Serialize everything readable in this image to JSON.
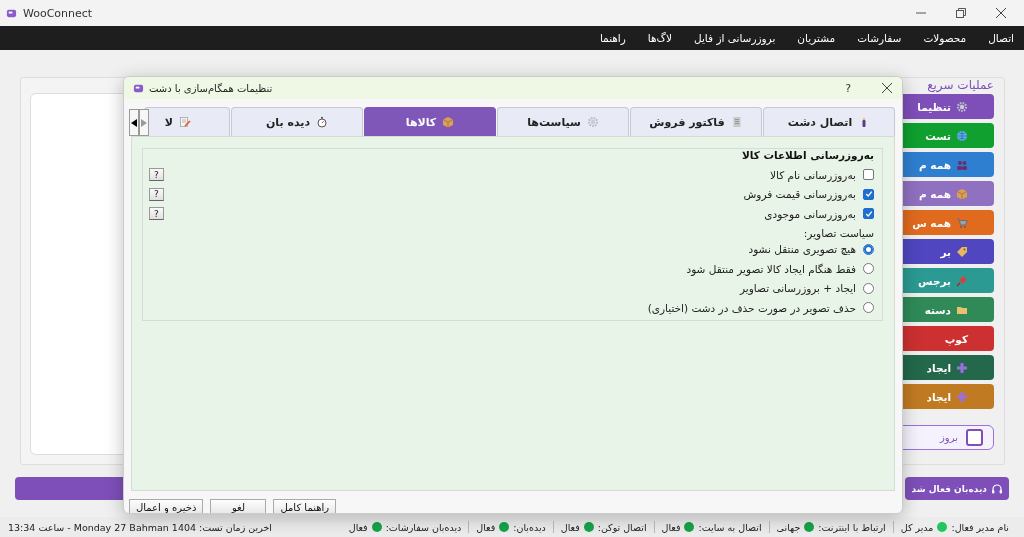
{
  "window": {
    "title": "WooConnect"
  },
  "menu": [
    "اتصال",
    "محصولات",
    "سفارشات",
    "مشتریان",
    "بروزرسانی از فایل",
    "لاگ‌ها",
    "راهنما"
  ],
  "quick_actions": {
    "title": "عملیات سریع",
    "buttons": [
      {
        "label": "تنظیما",
        "color": "#7e4fb8"
      },
      {
        "label": "تست",
        "color": "#0fa02f"
      },
      {
        "label": "همه م",
        "color": "#2f7fd0"
      },
      {
        "label": "همه م",
        "color": "#9070c0"
      },
      {
        "label": "همه س",
        "color": "#e06a1e"
      },
      {
        "label": "بر",
        "color": "#4f46c0"
      },
      {
        "label": "برجس",
        "color": "#2a9a92"
      },
      {
        "label": "دسته",
        "color": "#2f8a58"
      },
      {
        "label": "کوپ",
        "color": "#cc3030"
      },
      {
        "label": "ایجاد",
        "color": "#23684a"
      },
      {
        "label": "ایجاد",
        "color": "#c07a22"
      }
    ],
    "toggle": {
      "label": "بروز",
      "checked": false
    }
  },
  "watch_button": {
    "label": "دیده‌بان فعال شد"
  },
  "dialog": {
    "title": "تنظیمات همگام‌سازی با دشت",
    "help": "?",
    "tabs": [
      {
        "label": "اتصال دشت",
        "selected": false
      },
      {
        "label": "فاکتور فروش",
        "selected": false
      },
      {
        "label": "سیاست‌ها",
        "selected": false
      },
      {
        "label": "کالاها",
        "selected": true
      },
      {
        "label": "دیده بان",
        "selected": false
      },
      {
        "label": "لا",
        "selected": false
      }
    ],
    "group": {
      "title": "به‌روزرسانی اطلاعات کالا",
      "checkboxes": [
        {
          "label": "به‌روزرسانی نام کالا",
          "checked": false,
          "help": "?"
        },
        {
          "label": "به‌روزرسانی قیمت فروش",
          "checked": true,
          "help": "?"
        },
        {
          "label": "به‌روزرسانی موجودی",
          "checked": true,
          "help": "?"
        }
      ],
      "image_policy_label": "سیاست تصاویر:",
      "radios": [
        {
          "label": "هیچ تصویری منتقل نشود",
          "selected": true
        },
        {
          "label": "فقط هنگام ایجاد کالا تصویر منتقل شود",
          "selected": false
        },
        {
          "label": "ایجاد + بروزرسانی تصاویر",
          "selected": false
        },
        {
          "label": "حذف تصویر در صورت حذف در دشت (اختیاری)",
          "selected": false
        }
      ]
    },
    "buttons": [
      "راهنما کامل",
      "لغو",
      "ذخیره و اعمال"
    ]
  },
  "status_bar": {
    "items": [
      {
        "label": "نام مدیر فعال:",
        "value": "مدیر کل",
        "color": "#22c55e"
      },
      {
        "label": "ارتباط با اینترنت:",
        "value": "جهانی",
        "color": "#16a34a"
      },
      {
        "label": "اتصال به سایت:",
        "value": "فعال",
        "color": "#16a34a"
      },
      {
        "label": "اتصال توکن:",
        "value": "فعال",
        "color": "#16a34a"
      },
      {
        "label": "دیده‌بان:",
        "value": "فعال",
        "color": "#16a34a"
      },
      {
        "label": "دیده‌بان سفارشات:",
        "value": "فعال",
        "color": "#16a34a"
      }
    ],
    "last_test": "اخرین زمان تست: Monday 27 Bahman 1404 - ساعت 13:34"
  }
}
